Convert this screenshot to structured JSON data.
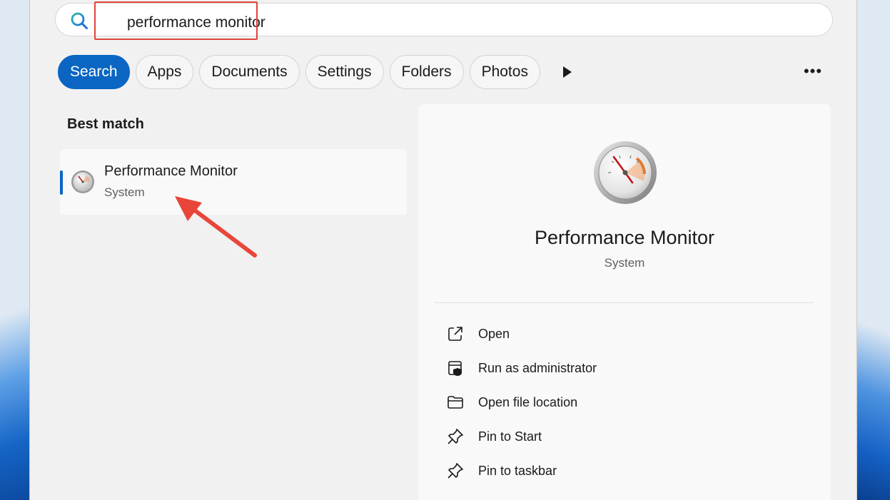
{
  "search": {
    "query": "performance monitor"
  },
  "filters": {
    "items": [
      "Search",
      "Apps",
      "Documents",
      "Settings",
      "Folders",
      "Photos"
    ],
    "active": "Search",
    "more_icon": "more-icon",
    "next_icon": "play-icon"
  },
  "results": {
    "section_title": "Best match",
    "best_match": {
      "name": "Performance Monitor",
      "type": "System",
      "icon": "performance-monitor-icon"
    }
  },
  "details": {
    "name": "Performance Monitor",
    "type": "System",
    "actions": [
      {
        "label": "Open",
        "icon": "open-external-icon"
      },
      {
        "label": "Run as administrator",
        "icon": "shield-admin-icon"
      },
      {
        "label": "Open file location",
        "icon": "folder-icon"
      },
      {
        "label": "Pin to Start",
        "icon": "pin-icon"
      },
      {
        "label": "Pin to taskbar",
        "icon": "pin-icon"
      }
    ]
  },
  "colors": {
    "accent": "#0a66c2",
    "highlight": "#e0453b",
    "panel_bg": "#f1f1f1"
  }
}
